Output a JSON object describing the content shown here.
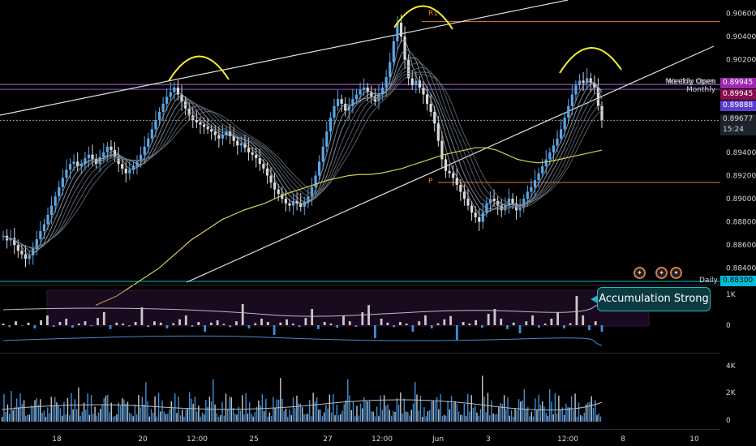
{
  "chart_data": {
    "type": "candlestick",
    "instrument_note": "",
    "price_axis": {
      "ticks": [
        "0.90600",
        "0.90400",
        "0.90200",
        "0.90000",
        "0.89800",
        "0.89600",
        "0.89400",
        "0.89200",
        "0.89000",
        "0.88800",
        "0.88600",
        "0.88400"
      ],
      "tick_values": [
        0.906,
        0.904,
        0.902,
        0.9,
        0.898,
        0.896,
        0.894,
        0.892,
        0.89,
        0.888,
        0.886,
        0.884
      ],
      "ylim": [
        0.883,
        0.9066
      ]
    },
    "time_axis": {
      "ticks": [
        "18",
        "20",
        "12:00",
        "25",
        "27",
        "12:00",
        "Jun",
        "3",
        "12:00",
        "8",
        "10"
      ]
    },
    "price_tags": {
      "weekly_open_label": "Weekly Open",
      "monthly_open_label": "Monthly Open",
      "monthly_label": "Monthly",
      "weekly_open_value": "0.89945",
      "monthly_value": "0.89945",
      "last_value": "0.89888",
      "current_value": "0.89677",
      "countdown": "15:24",
      "daily_label": "Daily",
      "daily_value": "0.88300"
    },
    "pivot_labels": {
      "r1": "R1",
      "p": "P"
    },
    "levels": {
      "r1": 0.9053,
      "p": 0.8914,
      "weekly_open": 0.89945,
      "monthly_open": 0.89945,
      "daily": 0.883
    },
    "close_series": [
      0.8868,
      0.8864,
      0.8866,
      0.886,
      0.8855,
      0.8852,
      0.8848,
      0.8851,
      0.8857,
      0.8865,
      0.8872,
      0.8878,
      0.8886,
      0.8894,
      0.8902,
      0.891,
      0.8918,
      0.8925,
      0.893,
      0.8932,
      0.8928,
      0.893,
      0.8935,
      0.8938,
      0.8934,
      0.893,
      0.8936,
      0.894,
      0.8945,
      0.8942,
      0.8936,
      0.893,
      0.8926,
      0.8922,
      0.8925,
      0.8928,
      0.8932,
      0.8938,
      0.8945,
      0.8952,
      0.896,
      0.8968,
      0.8975,
      0.8982,
      0.8988,
      0.8992,
      0.8996,
      0.899,
      0.8984,
      0.8978,
      0.8972,
      0.8968,
      0.8966,
      0.8964,
      0.8962,
      0.896,
      0.8958,
      0.8955,
      0.8952,
      0.8955,
      0.8958,
      0.8954,
      0.895,
      0.8946,
      0.8948,
      0.8944,
      0.894,
      0.8938,
      0.8935,
      0.893,
      0.8926,
      0.892,
      0.8914,
      0.8908,
      0.8904,
      0.89,
      0.8896,
      0.8894,
      0.8898,
      0.8896,
      0.8893,
      0.8897,
      0.8902,
      0.891,
      0.892,
      0.8932,
      0.8945,
      0.8958,
      0.897,
      0.898,
      0.8986,
      0.8982,
      0.8976,
      0.898,
      0.8986,
      0.899,
      0.8994,
      0.8996,
      0.8992,
      0.8988,
      0.8984,
      0.899,
      0.8996,
      0.9005,
      0.9018,
      0.9036,
      0.9052,
      0.904,
      0.902,
      0.9004,
      0.8998,
      0.9002,
      0.8996,
      0.899,
      0.8982,
      0.8975,
      0.8965,
      0.895,
      0.8934,
      0.8924,
      0.8922,
      0.8918,
      0.8912,
      0.8906,
      0.89,
      0.8894,
      0.8888,
      0.8884,
      0.888,
      0.8888,
      0.8896,
      0.89,
      0.8898,
      0.8894,
      0.889,
      0.8894,
      0.89,
      0.8896,
      0.889,
      0.8892,
      0.89,
      0.8906,
      0.891,
      0.8916,
      0.8922,
      0.8928,
      0.8934,
      0.894,
      0.8946,
      0.8952,
      0.896,
      0.897,
      0.898,
      0.899,
      0.8998,
      0.9002,
      0.9,
      0.9004,
      0.9,
      0.8996,
      0.898,
      0.8968
    ],
    "ma_long": [
      0.8808,
      0.8812,
      0.8816,
      0.8822,
      0.8828,
      0.8834,
      0.884,
      0.8848,
      0.8856,
      0.8864,
      0.887,
      0.8876,
      0.8882,
      0.8886,
      0.889,
      0.8893,
      0.8896,
      0.89,
      0.8904,
      0.8907,
      0.891,
      0.8913,
      0.8916,
      0.8918,
      0.892,
      0.8921,
      0.8921,
      0.8922,
      0.8924,
      0.8926,
      0.8929,
      0.8932,
      0.8935,
      0.8938,
      0.894,
      0.8942,
      0.8944,
      0.8944,
      0.8942,
      0.8938,
      0.8934,
      0.8932,
      0.8931,
      0.8932,
      0.8934,
      0.8936,
      0.8938,
      0.894,
      0.8942
    ],
    "ma_long_label": "",
    "oscillator": {
      "ticks": [
        "1K",
        "0"
      ],
      "callout": "Accumulation Strong",
      "bars": [
        0.05,
        -0.06,
        0.12,
        -0.02,
        0.08,
        -0.1,
        0.15,
        0.3,
        -0.05,
        0.1,
        0.2,
        -0.08,
        0.05,
        0.12,
        -0.03,
        0.22,
        0.4,
        -0.12,
        0.08,
        0.05,
        -0.04,
        0.1,
        0.55,
        -0.06,
        0.12,
        0.08,
        -0.1,
        0.06,
        0.18,
        0.3,
        -0.05,
        0.1,
        -0.2,
        0.08,
        0.15,
        0.04,
        -0.06,
        0.12,
        0.65,
        -0.1,
        0.06,
        0.2,
        0.1,
        -0.3,
        0.08,
        0.18,
        0.05,
        -0.06,
        0.22,
        0.5,
        -0.12,
        0.1,
        0.05,
        -0.08,
        0.3,
        0.12,
        -0.05,
        0.4,
        0.62,
        -0.4,
        0.2,
        0.08,
        -0.06,
        0.1,
        0.05,
        -0.2,
        0.12,
        0.3,
        -0.1,
        0.06,
        0.18,
        0.28,
        -0.45,
        0.1,
        0.05,
        0.15,
        -0.08,
        0.35,
        0.5,
        0.2,
        -0.12,
        0.08,
        -0.25,
        0.12,
        0.3,
        -0.08,
        0.05,
        0.2,
        0.4,
        -0.1,
        0.06,
        0.9,
        0.3,
        -0.15,
        0.12,
        -0.2
      ]
    },
    "volume": {
      "ticks": [
        "4K",
        "2K",
        "0"
      ]
    }
  }
}
